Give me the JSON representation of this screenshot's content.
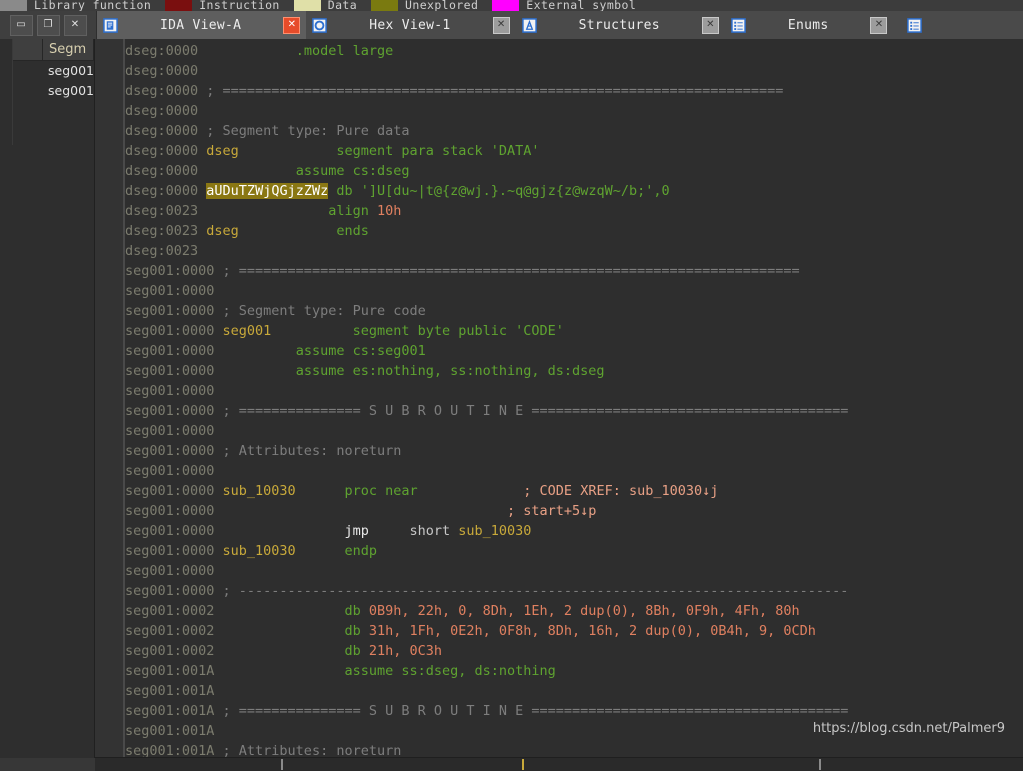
{
  "legend": {
    "items": [
      {
        "label": "Library function",
        "color": "#8a8a8a"
      },
      {
        "label": "Instruction",
        "color": "#7a0f0f"
      },
      {
        "label": "Data",
        "color": "#e0e0a8"
      },
      {
        "label": "Unexplored",
        "color": "#7a7a10"
      },
      {
        "label": "External symbol",
        "color": "#ff00ff"
      }
    ]
  },
  "mdi_controls": {
    "minimize_label": "▭",
    "restore_label": "❐",
    "close_label": "✕"
  },
  "tabs": [
    {
      "label": "IDA View-A",
      "icon": "ida-view-icon",
      "active": true,
      "close_hot": true
    },
    {
      "label": "Hex View-1",
      "icon": "hex-view-icon",
      "active": false,
      "close_hot": false
    },
    {
      "label": "Structures",
      "icon": "structures-icon",
      "active": false,
      "close_hot": false
    },
    {
      "label": "Enums",
      "icon": "enums-icon",
      "active": false,
      "close_hot": false
    }
  ],
  "tab_close_label": "✕",
  "left_panel": {
    "header": "Segm",
    "rows": [
      "seg001",
      "seg001"
    ]
  },
  "watermark": "https://blog.csdn.net/Palmer9",
  "disassembly": {
    "lines": [
      {
        "addr": "dseg:0000",
        "marker": "none",
        "tokens": [
          {
            "t": "            ",
            "c": "t-opd"
          },
          {
            "t": ".model large",
            "c": "t-dir"
          }
        ]
      },
      {
        "addr": "dseg:0000",
        "marker": "none",
        "tokens": []
      },
      {
        "addr": "dseg:0000",
        "marker": "none",
        "tokens": [
          {
            "t": " ; =====================================================================",
            "c": "t-cmt"
          }
        ]
      },
      {
        "addr": "dseg:0000",
        "marker": "none",
        "tokens": []
      },
      {
        "addr": "dseg:0000",
        "marker": "none",
        "tokens": [
          {
            "t": " ; Segment type: Pure data",
            "c": "t-cmt"
          }
        ]
      },
      {
        "addr": "dseg:0000",
        "marker": "none",
        "tokens": [
          {
            "t": " dseg",
            "c": "t-seg"
          },
          {
            "t": "            ",
            "c": "t-opd"
          },
          {
            "t": "segment para stack 'DATA'",
            "c": "t-kw"
          }
        ]
      },
      {
        "addr": "dseg:0000",
        "marker": "none",
        "tokens": [
          {
            "t": "            ",
            "c": "t-opd"
          },
          {
            "t": "assume cs:dseg",
            "c": "t-kw"
          }
        ]
      },
      {
        "addr": "dseg:0000",
        "marker": "dot",
        "tokens": [
          {
            "t": " ",
            "c": "t-opd"
          },
          {
            "t": "aUDuTZWjQGjzZWz",
            "c": "hl"
          },
          {
            "t": " ",
            "c": "t-opd"
          },
          {
            "t": "db",
            "c": "t-kw"
          },
          {
            "t": " ']U[du~|t@{z@wj.}.~q@gjz{z@wzqW~/b;',0",
            "c": "t-str"
          }
        ]
      },
      {
        "addr": "dseg:0023",
        "marker": "dot",
        "tokens": [
          {
            "t": "                ",
            "c": "t-opd"
          },
          {
            "t": "align",
            "c": "t-kw"
          },
          {
            "t": " ",
            "c": "t-opd"
          },
          {
            "t": "10h",
            "c": "t-num"
          }
        ]
      },
      {
        "addr": "dseg:0023",
        "marker": "none",
        "tokens": [
          {
            "t": " dseg",
            "c": "t-seg"
          },
          {
            "t": "            ",
            "c": "t-opd"
          },
          {
            "t": "ends",
            "c": "t-kw"
          }
        ]
      },
      {
        "addr": "dseg:0023",
        "marker": "none",
        "tokens": []
      },
      {
        "addr": "seg001:0000",
        "marker": "none",
        "tokens": [
          {
            "t": " ; =====================================================================",
            "c": "t-cmt"
          }
        ]
      },
      {
        "addr": "seg001:0000",
        "marker": "none",
        "tokens": []
      },
      {
        "addr": "seg001:0000",
        "marker": "none",
        "tokens": [
          {
            "t": " ; Segment type: Pure code",
            "c": "t-cmt"
          }
        ]
      },
      {
        "addr": "seg001:0000",
        "marker": "none",
        "tokens": [
          {
            "t": " seg001",
            "c": "t-seg"
          },
          {
            "t": "          ",
            "c": "t-opd"
          },
          {
            "t": "segment byte public 'CODE'",
            "c": "t-kw"
          }
        ]
      },
      {
        "addr": "seg001:0000",
        "marker": "none",
        "tokens": [
          {
            "t": "          ",
            "c": "t-opd"
          },
          {
            "t": "assume cs:seg001",
            "c": "t-kw"
          }
        ]
      },
      {
        "addr": "seg001:0000",
        "marker": "none",
        "tokens": [
          {
            "t": "          ",
            "c": "t-opd"
          },
          {
            "t": "assume es:nothing, ss:nothing, ds:dseg",
            "c": "t-kw"
          }
        ]
      },
      {
        "addr": "seg001:0000",
        "marker": "none",
        "tokens": []
      },
      {
        "addr": "seg001:0000",
        "marker": "none",
        "tokens": [
          {
            "t": " ; =============== S U B R O U T I N E =======================================",
            "c": "t-cmt"
          }
        ]
      },
      {
        "addr": "seg001:0000",
        "marker": "none",
        "tokens": []
      },
      {
        "addr": "seg001:0000",
        "marker": "none",
        "tokens": [
          {
            "t": " ; Attributes: noreturn",
            "c": "t-cmt"
          }
        ]
      },
      {
        "addr": "seg001:0000",
        "marker": "none",
        "tokens": []
      },
      {
        "addr": "seg001:0000",
        "marker": "none",
        "tokens": [
          {
            "t": " sub_10030",
            "c": "t-name"
          },
          {
            "t": "      ",
            "c": "t-opd"
          },
          {
            "t": "proc near",
            "c": "t-kw"
          },
          {
            "t": "             ",
            "c": "t-opd"
          },
          {
            "t": "; CODE XREF: sub_10030↓j",
            "c": "t-xref"
          }
        ]
      },
      {
        "addr": "seg001:0000",
        "marker": "none",
        "tokens": [
          {
            "t": "                                    ",
            "c": "t-opd"
          },
          {
            "t": "; start+5↓p",
            "c": "t-xref"
          }
        ]
      },
      {
        "addr": "seg001:0000",
        "marker": "jump",
        "tokens": [
          {
            "t": "                ",
            "c": "t-opd"
          },
          {
            "t": "jmp",
            "c": "t-ins"
          },
          {
            "t": "     ",
            "c": "t-opd"
          },
          {
            "t": "short ",
            "c": "t-opd"
          },
          {
            "t": "sub_10030",
            "c": "t-name"
          }
        ]
      },
      {
        "addr": "seg001:0000",
        "marker": "none",
        "tokens": [
          {
            "t": " sub_10030",
            "c": "t-name"
          },
          {
            "t": "      ",
            "c": "t-opd"
          },
          {
            "t": "endp",
            "c": "t-kw"
          }
        ]
      },
      {
        "addr": "seg001:0000",
        "marker": "none",
        "tokens": []
      },
      {
        "addr": "seg001:0000",
        "marker": "none",
        "tokens": [
          {
            "t": " ; ---------------------------------------------------------------------------",
            "c": "t-cmt"
          }
        ]
      },
      {
        "addr": "seg001:0002",
        "marker": "dot",
        "tokens": [
          {
            "t": "                ",
            "c": "t-opd"
          },
          {
            "t": "db",
            "c": "t-kw"
          },
          {
            "t": " ",
            "c": "t-opd"
          },
          {
            "t": "0B9h, 22h, 0, 8Dh, 1Eh, 2 dup(0), 8Bh, 0F9h, 4Fh, 80h",
            "c": "t-num"
          }
        ]
      },
      {
        "addr": "seg001:0002",
        "marker": "none",
        "tokens": [
          {
            "t": "                ",
            "c": "t-opd"
          },
          {
            "t": "db",
            "c": "t-kw"
          },
          {
            "t": " ",
            "c": "t-opd"
          },
          {
            "t": "31h, 1Fh, 0E2h, 0F8h, 8Dh, 16h, 2 dup(0), 0B4h, 9, 0CDh",
            "c": "t-num"
          }
        ]
      },
      {
        "addr": "seg001:0002",
        "marker": "none",
        "tokens": [
          {
            "t": "                ",
            "c": "t-opd"
          },
          {
            "t": "db",
            "c": "t-kw"
          },
          {
            "t": " ",
            "c": "t-opd"
          },
          {
            "t": "21h, 0C3h",
            "c": "t-num"
          }
        ]
      },
      {
        "addr": "seg001:001A",
        "marker": "none",
        "tokens": [
          {
            "t": "                ",
            "c": "t-opd"
          },
          {
            "t": "assume ss:dseg, ds:nothing",
            "c": "t-kw"
          }
        ]
      },
      {
        "addr": "seg001:001A",
        "marker": "none",
        "tokens": []
      },
      {
        "addr": "seg001:001A",
        "marker": "none",
        "tokens": [
          {
            "t": " ; =============== S U B R O U T I N E =======================================",
            "c": "t-cmt"
          }
        ]
      },
      {
        "addr": "seg001:001A",
        "marker": "none",
        "tokens": []
      },
      {
        "addr": "seg001:001A",
        "marker": "none",
        "tokens": [
          {
            "t": " ; Attributes: noreturn",
            "c": "t-cmt"
          }
        ]
      }
    ]
  },
  "navigator": {
    "ticks_pct": [
      20,
      46,
      78
    ]
  }
}
